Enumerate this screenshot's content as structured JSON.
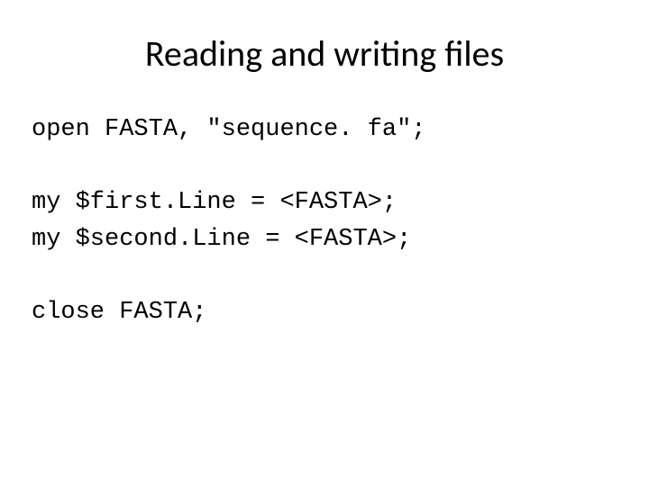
{
  "title": "Reading and writing files",
  "code": {
    "line1": "open FASTA, \"sequence. fa\";",
    "blank1": "",
    "line2": "my $first.Line = <FASTA>;",
    "line3": "my $second.Line = <FASTA>;",
    "blank2": "",
    "line4": "close FASTA;"
  }
}
